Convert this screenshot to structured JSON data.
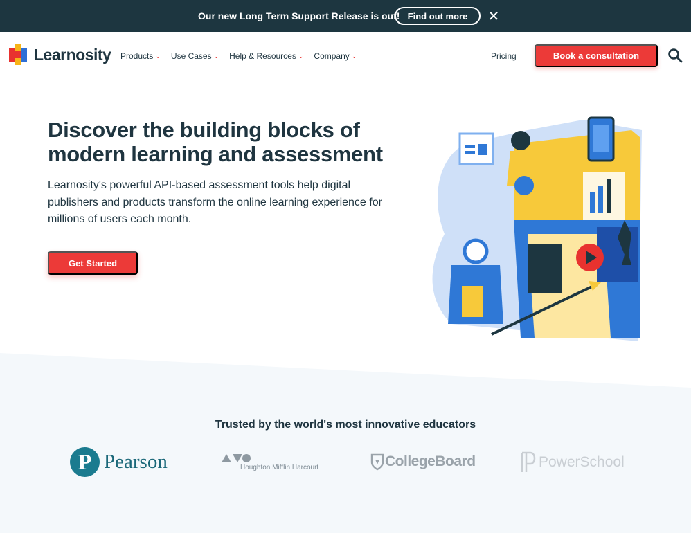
{
  "announcement": {
    "text": "Our new Long Term Support Release is out!",
    "button_label": "Find out more",
    "close_icon": "close-icon"
  },
  "nav": {
    "logo_text": "Learnosity",
    "menu": [
      {
        "label": "Products"
      },
      {
        "label": "Use Cases"
      },
      {
        "label": "Help & Resources"
      },
      {
        "label": "Company"
      }
    ],
    "pricing_label": "Pricing",
    "cta_label": "Book a consultation",
    "search_icon": "search-icon"
  },
  "hero": {
    "title": "Discover the building blocks of modern learning and assessment",
    "subtitle": "Learnosity's powerful API-based assessment tools help digital publishers and products transform the online learning experience for millions of users each month.",
    "cta_label": "Get Started"
  },
  "trusted": {
    "title": "Trusted by the world's most innovative educators",
    "brands": [
      {
        "name": "Pearson",
        "mark": "P"
      },
      {
        "name": "Houghton Mifflin Harcourt"
      },
      {
        "name": "CollegeBoard"
      },
      {
        "name": "PowerSchool"
      }
    ]
  },
  "colors": {
    "announcement_bg": "#1d3640",
    "accent_red": "#ec3a38",
    "text_dark": "#1f3540",
    "trusted_bg": "#f4f8fb"
  }
}
